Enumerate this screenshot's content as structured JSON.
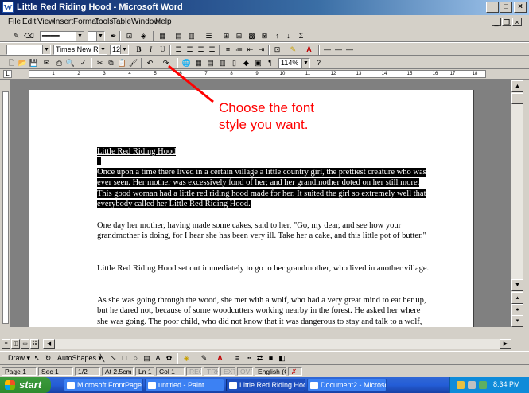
{
  "window": {
    "title": "Little Red Riding Hood - Microsoft Word",
    "icon": "W"
  },
  "menu": [
    "File",
    "Edit",
    "View",
    "Insert",
    "Format",
    "Tools",
    "Table",
    "Window",
    "Help"
  ],
  "formatting": {
    "style_value": "",
    "font_value": "Times New Roman",
    "size_value": "12",
    "bold": "B",
    "italic": "I",
    "underline": "U"
  },
  "standard": {
    "zoom_value": "114%"
  },
  "ruler_numbers": [
    "1",
    "2",
    "3",
    "4",
    "5",
    "6",
    "7",
    "8",
    "9",
    "10",
    "11",
    "12",
    "13",
    "14",
    "15",
    "16",
    "17",
    "18"
  ],
  "annotation": {
    "line1": "Choose the font",
    "line2": "style you want."
  },
  "document": {
    "title_line": "Little Red Riding Hood",
    "paragraph1": "Once upon a time there lived in a certain village a little country girl, the prettiest creature who was ever seen. Her mother was excessively fond of her; and her grandmother doted on her still more. This good woman had a little red riding hood made for her. It suited the girl so extremely well that everybody called her Little Red Riding Hood.",
    "paragraph2": "One day her mother, having made some cakes, said to her, \"Go, my dear, and see how your grandmother is doing, for I hear she has been very ill. Take her a cake, and this little pot of butter.\"",
    "paragraph3": "Little Red Riding Hood set out immediately to go to her grandmother, who lived in another village.",
    "paragraph4": "As she was going through the wood, she met with a wolf, who had a very great mind to eat her up, but he dared not, because of some woodcutters working nearby in the forest. He asked her where she was going. The poor child, who did not know that it was dangerous to stay and talk to a wolf, said to him, \"I am going to see my grandmother and carry her a cake and a little pot of butter from my mother.\""
  },
  "drawing": {
    "draw_label": "Draw",
    "autoshapes_label": "AutoShapes"
  },
  "status": {
    "page": "Page 1",
    "section": "Sec 1",
    "page_of": "1/2",
    "at": "At 2.5cm",
    "line": "Ln 1",
    "col": "Col 1",
    "rec": "REC",
    "trk": "TRK",
    "ext": "EXT",
    "ovr": "OVR",
    "language": "English (Ca"
  },
  "taskbar": {
    "start_label": "start",
    "tasks": [
      "Microsoft FrontPage - ...",
      "untitled - Paint",
      "Little Red Riding Hoo...",
      "Document2 - Microsof..."
    ],
    "clock": "8:34 PM"
  },
  "colors": {
    "annotation": "#ff0000",
    "titlebar": "#0a246a",
    "taskbar": "#245dd7",
    "start": "#2f8b2f"
  }
}
